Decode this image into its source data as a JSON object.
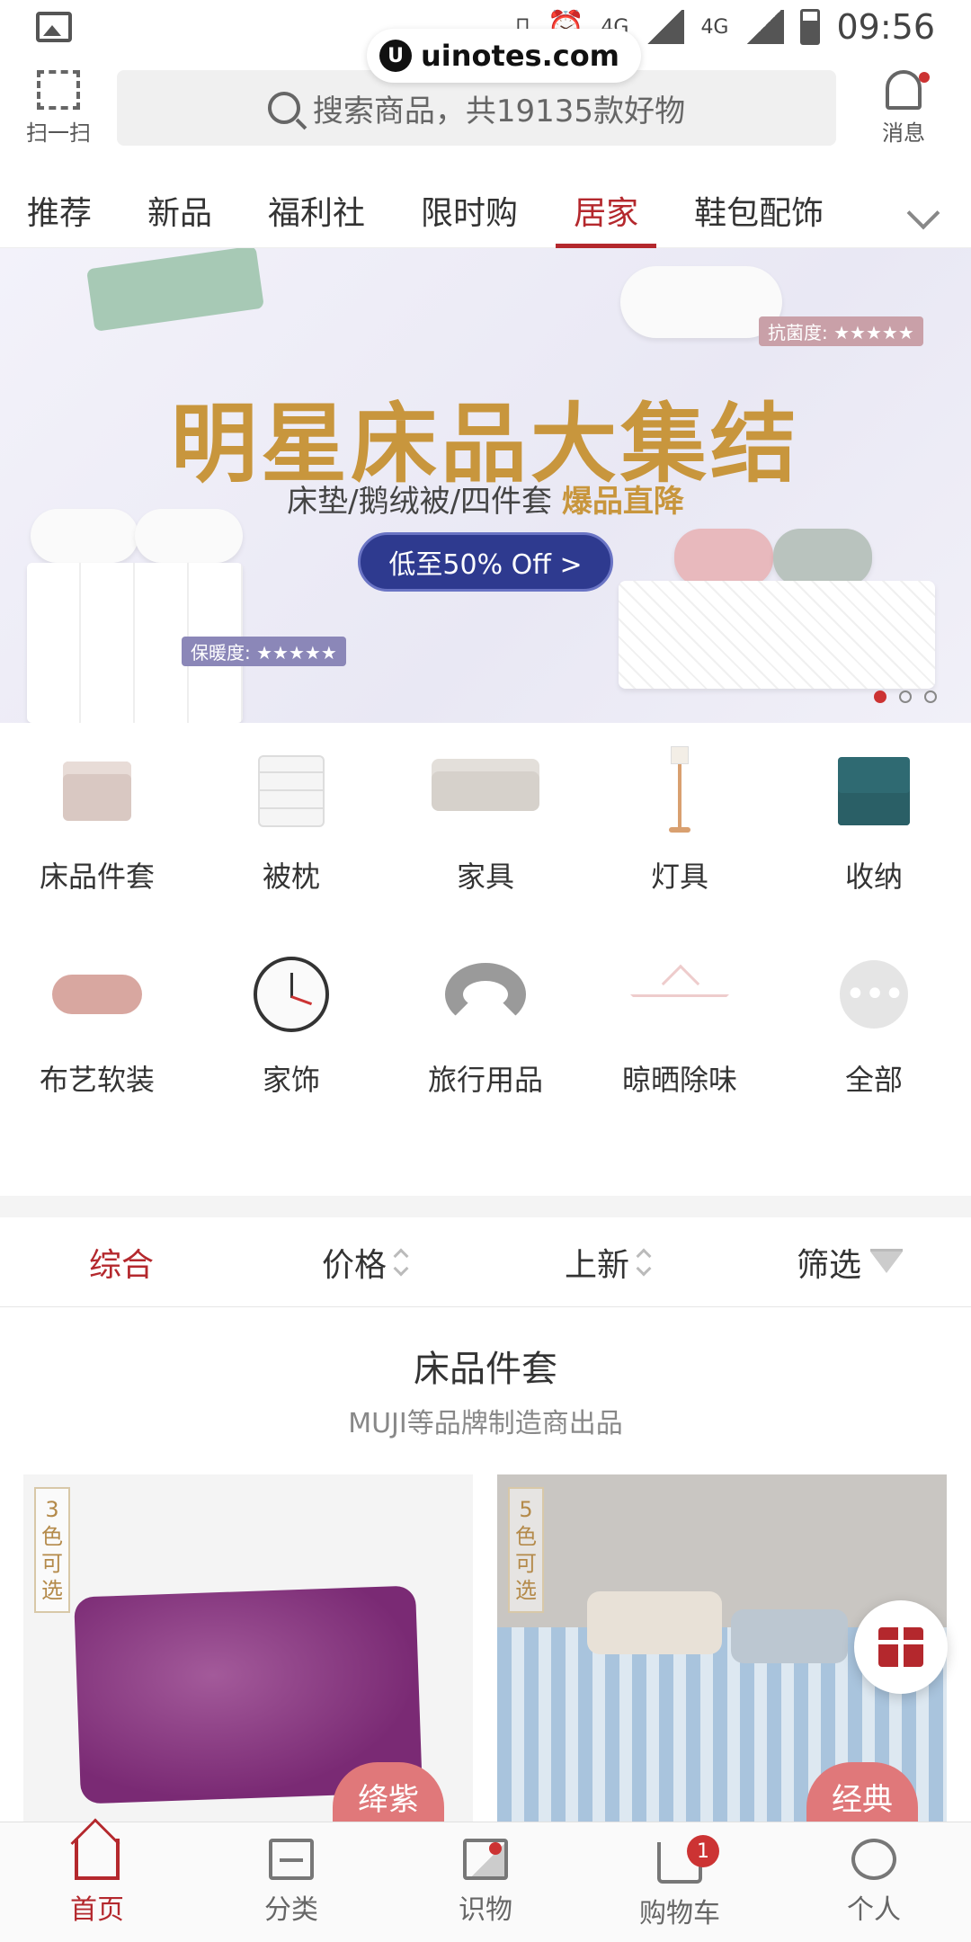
{
  "status_bar": {
    "time": "09:56",
    "network_a": "4G",
    "network_b": "4G"
  },
  "watermark": {
    "logo": "U",
    "text": "uinotes.com"
  },
  "header": {
    "scan_label": "扫一扫",
    "search_placeholder": "搜索商品，共19135款好物",
    "message_label": "消息"
  },
  "tabs": [
    {
      "label": "推荐"
    },
    {
      "label": "新品"
    },
    {
      "label": "福利社"
    },
    {
      "label": "限时购"
    },
    {
      "label": "居家",
      "active": true
    },
    {
      "label": "鞋包配饰"
    }
  ],
  "banner": {
    "title": "明星床品大集结",
    "subtitle": "床垫/鹅绒被/四件套",
    "subtitle_highlight": "爆品直降",
    "cta": "低至50% Off >",
    "tag_antibacterial": "抗菌度: ★★★★★",
    "tag_warmth": "保暖度: ★★★★★",
    "carousel_index": 1,
    "carousel_total": 3
  },
  "categories": [
    {
      "label": "床品件套",
      "icon": "bedding-icon"
    },
    {
      "label": "被枕",
      "icon": "quilt-icon"
    },
    {
      "label": "家具",
      "icon": "sofa-icon"
    },
    {
      "label": "灯具",
      "icon": "lamp-icon"
    },
    {
      "label": "收纳",
      "icon": "cabinet-icon"
    },
    {
      "label": "布艺软装",
      "icon": "plush-icon"
    },
    {
      "label": "家饰",
      "icon": "clock-icon"
    },
    {
      "label": "旅行用品",
      "icon": "neck-pillow-icon"
    },
    {
      "label": "晾晒除味",
      "icon": "hanger-icon"
    },
    {
      "label": "全部",
      "icon": "more-icon"
    }
  ],
  "sort": {
    "comprehensive": "综合",
    "price": "价格",
    "new": "上新",
    "filter": "筛选"
  },
  "section": {
    "title": "床品件套",
    "subtitle": "MUJI等品牌制造商出品"
  },
  "products": [
    {
      "colors_text": "3色可选",
      "badge": "绛紫"
    },
    {
      "colors_text": "5色可选",
      "badge": "经典"
    }
  ],
  "bottom_nav": {
    "home": "首页",
    "category": "分类",
    "knowledge": "识物",
    "cart": "购物车",
    "cart_count": "1",
    "profile": "个人"
  },
  "colors": {
    "brand_red": "#b4282d",
    "banner_gold": "#c8963d",
    "cta_blue": "#2e3a8f"
  }
}
